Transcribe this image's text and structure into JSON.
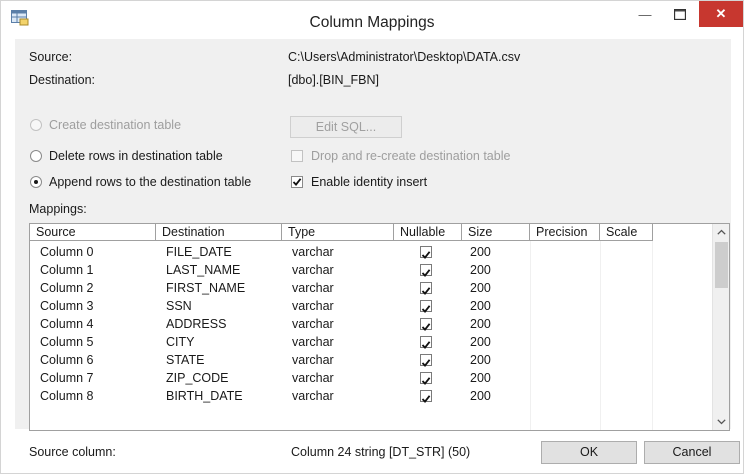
{
  "window": {
    "title": "Column Mappings",
    "minimize_glyph": "—",
    "close_glyph": "✕"
  },
  "source": {
    "label": "Source:",
    "value": "C:\\Users\\Administrator\\Desktop\\DATA.csv"
  },
  "destination": {
    "label": "Destination:",
    "value": "[dbo].[BIN_FBN]"
  },
  "options": {
    "create_table": {
      "label": "Create destination table",
      "checked": false,
      "enabled": false
    },
    "delete_rows": {
      "label": "Delete rows in destination table",
      "checked": false,
      "enabled": true
    },
    "append_rows": {
      "label": "Append rows to the destination table",
      "checked": true,
      "enabled": true
    },
    "edit_sql": {
      "label": "Edit SQL...",
      "enabled": false
    },
    "drop_recreate": {
      "label": "Drop and re-create destination table",
      "checked": false,
      "enabled": false
    },
    "identity_insert": {
      "label": "Enable identity insert",
      "checked": true,
      "enabled": true
    }
  },
  "mappings": {
    "label": "Mappings:",
    "columns": [
      "Source",
      "Destination",
      "Type",
      "Nullable",
      "Size",
      "Precision",
      "Scale"
    ],
    "rows": [
      {
        "source": "Column 0",
        "destination": "FILE_DATE",
        "type": "varchar",
        "nullable": true,
        "size": "200",
        "precision": "",
        "scale": ""
      },
      {
        "source": "Column 1",
        "destination": "LAST_NAME",
        "type": "varchar",
        "nullable": true,
        "size": "200",
        "precision": "",
        "scale": ""
      },
      {
        "source": "Column 2",
        "destination": "FIRST_NAME",
        "type": "varchar",
        "nullable": true,
        "size": "200",
        "precision": "",
        "scale": ""
      },
      {
        "source": "Column 3",
        "destination": "SSN",
        "type": "varchar",
        "nullable": true,
        "size": "200",
        "precision": "",
        "scale": ""
      },
      {
        "source": "Column 4",
        "destination": "ADDRESS",
        "type": "varchar",
        "nullable": true,
        "size": "200",
        "precision": "",
        "scale": ""
      },
      {
        "source": "Column 5",
        "destination": "CITY",
        "type": "varchar",
        "nullable": true,
        "size": "200",
        "precision": "",
        "scale": ""
      },
      {
        "source": "Column 6",
        "destination": "STATE",
        "type": "varchar",
        "nullable": true,
        "size": "200",
        "precision": "",
        "scale": ""
      },
      {
        "source": "Column 7",
        "destination": "ZIP_CODE",
        "type": "varchar",
        "nullable": true,
        "size": "200",
        "precision": "",
        "scale": ""
      },
      {
        "source": "Column 8",
        "destination": "BIRTH_DATE",
        "type": "varchar",
        "nullable": true,
        "size": "200",
        "precision": "",
        "scale": ""
      }
    ]
  },
  "source_column": {
    "label": "Source column:",
    "value": "Column 24 string [DT_STR] (50)"
  },
  "buttons": {
    "ok": "OK",
    "cancel": "Cancel"
  },
  "icons": {
    "app": "table-window-icon",
    "minimize": "minimize-icon",
    "maximize": "maximize-icon",
    "close": "close-icon",
    "scroll_up": "chevron-up-icon",
    "scroll_down": "chevron-down-icon"
  },
  "colors": {
    "close_button": "#c7372f",
    "panel": "#f0f0f0",
    "disabled_text": "#9e9e9e"
  }
}
